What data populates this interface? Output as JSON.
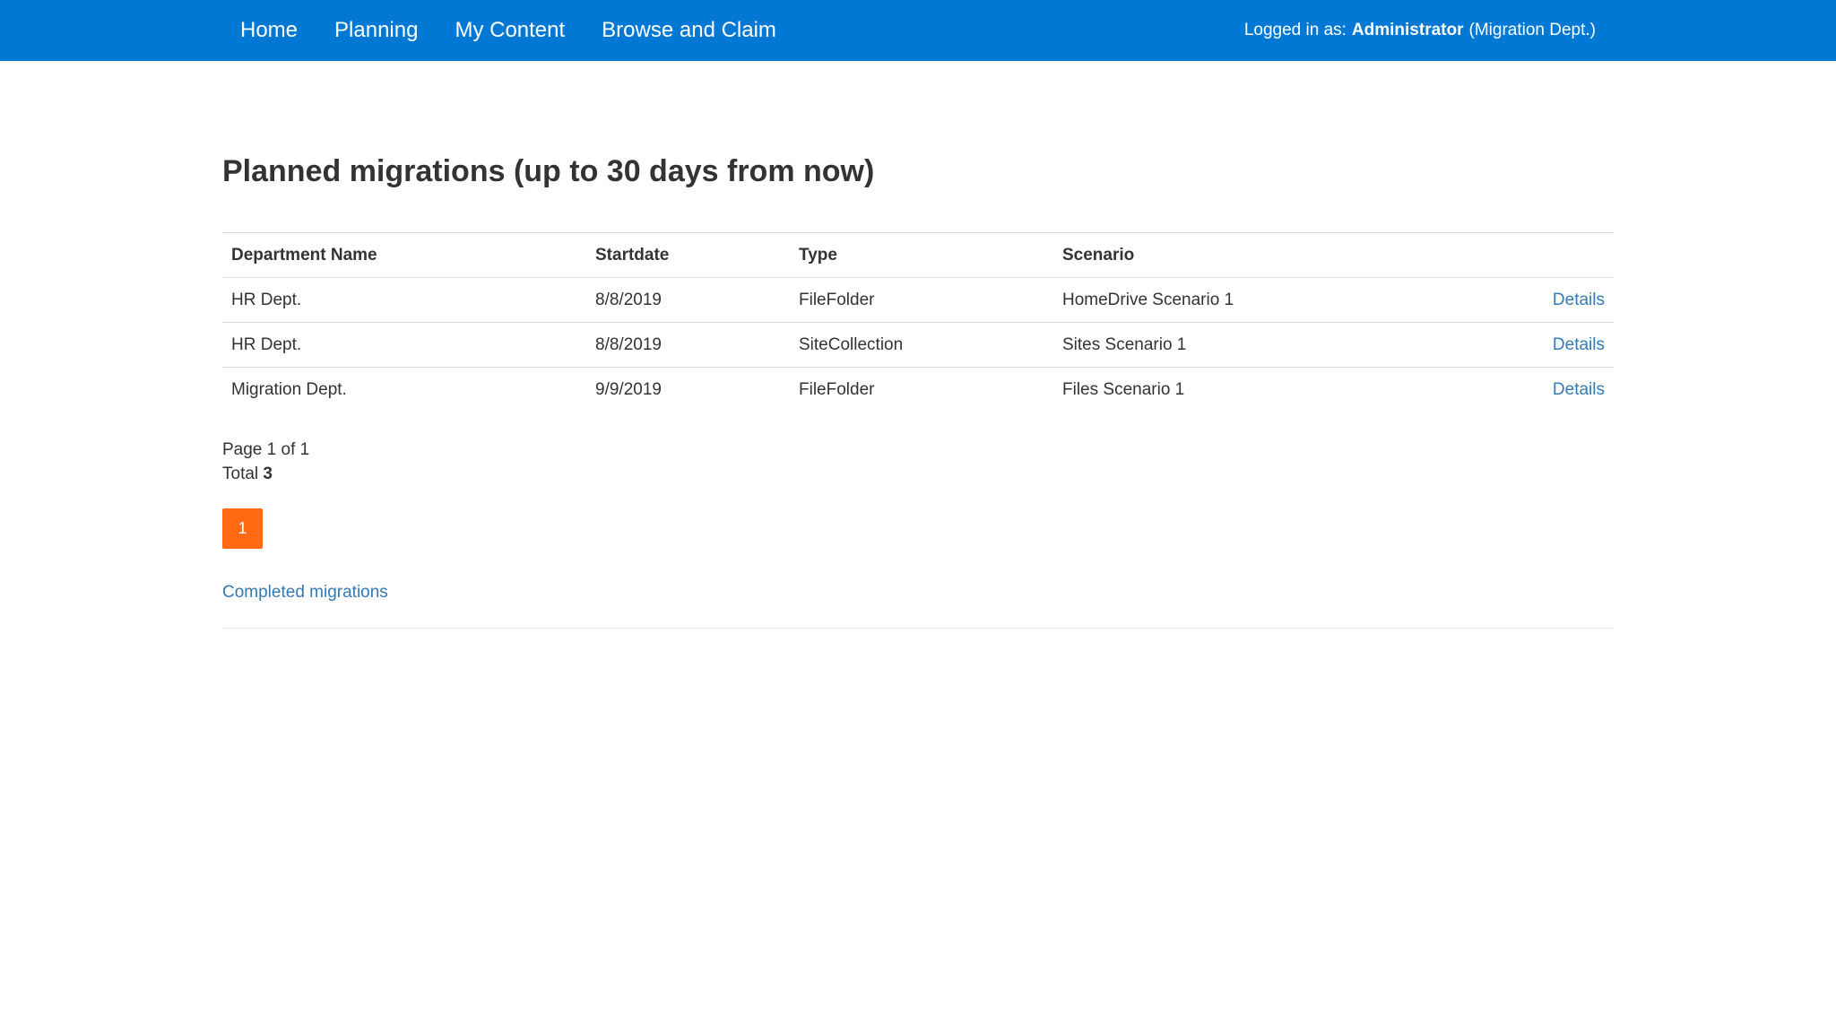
{
  "nav": {
    "items": [
      "Home",
      "Planning",
      "My Content",
      "Browse and Claim"
    ],
    "user": {
      "prefix": "Logged in as:",
      "name": "Administrator",
      "department": "(Migration Dept.)"
    }
  },
  "main": {
    "title": "Planned migrations (up to 30 days from now)",
    "table": {
      "headers": [
        "Department Name",
        "Startdate",
        "Type",
        "Scenario",
        ""
      ],
      "rows": [
        {
          "department": "HR Dept.",
          "startdate": "8/8/2019",
          "type": "FileFolder",
          "scenario": "HomeDrive Scenario 1",
          "action": "Details"
        },
        {
          "department": "HR Dept.",
          "startdate": "8/8/2019",
          "type": "SiteCollection",
          "scenario": "Sites Scenario 1",
          "action": "Details"
        },
        {
          "department": "Migration Dept.",
          "startdate": "9/9/2019",
          "type": "FileFolder",
          "scenario": "Files Scenario 1",
          "action": "Details"
        }
      ]
    },
    "pager": {
      "page_info": "Page 1 of 1",
      "total_label": "Total",
      "total_value": "3",
      "current_page": "1"
    },
    "completed_link": "Completed migrations"
  },
  "colors": {
    "navbar": "#0078d4",
    "link": "#337ab7",
    "pager_active": "#ff6a13"
  }
}
